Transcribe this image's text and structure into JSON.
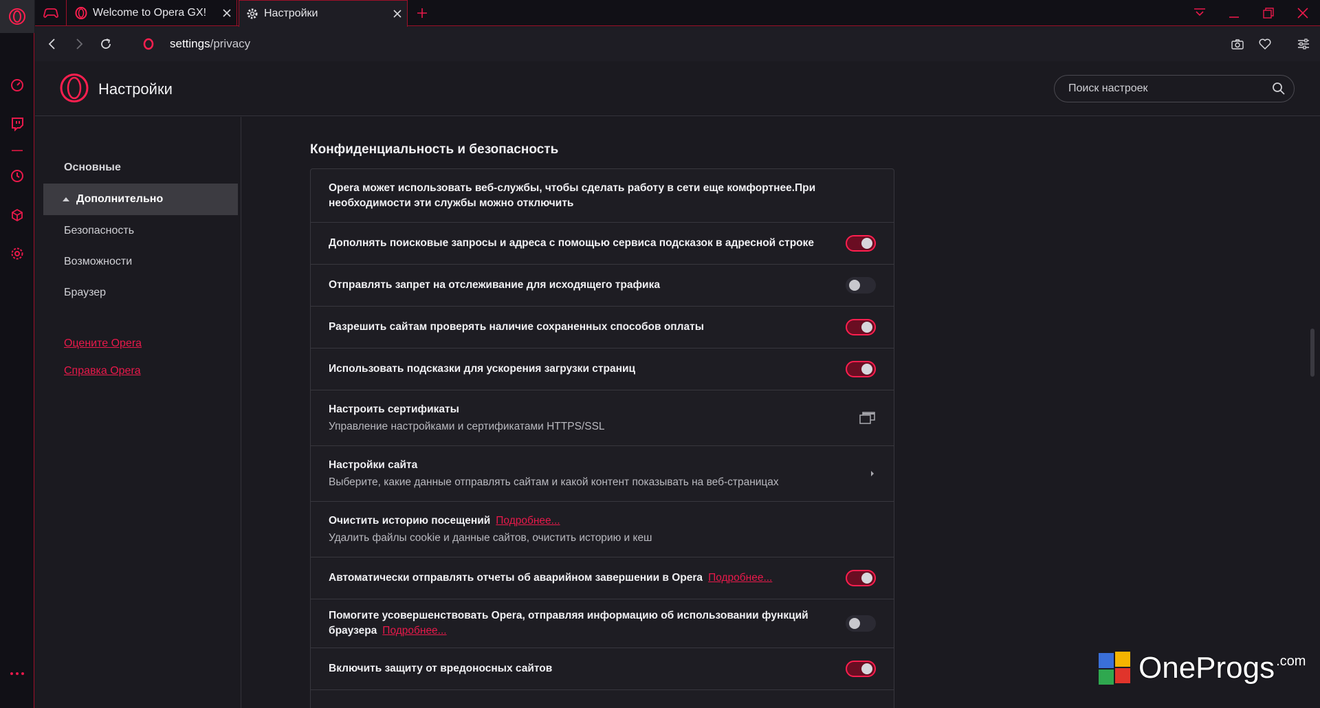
{
  "browser": {
    "tabs": [
      {
        "title": "Welcome to Opera GX!"
      },
      {
        "title": "Настройки"
      }
    ],
    "url_prefix": "settings",
    "url_path": "/privacy"
  },
  "colors": {
    "accent": "#ff1f4f",
    "background": "#1b1a20",
    "card": "#1e1d23"
  },
  "header": {
    "title": "Настройки",
    "search_placeholder": "Поиск настроек"
  },
  "nav": {
    "items": [
      {
        "label": "Основные"
      },
      {
        "label": "Дополнительно"
      },
      {
        "label": "Безопасность"
      },
      {
        "label": "Возможности"
      },
      {
        "label": "Браузер"
      }
    ],
    "links": [
      {
        "label": "Оцените Opera"
      },
      {
        "label": "Справка Opera"
      }
    ]
  },
  "section": {
    "title": "Конфиденциальность и безопасность",
    "intro": "Opera может использовать веб-службы, чтобы сделать работу в сети еще комфортнее.При необходимости эти службы можно отключить",
    "rows": [
      {
        "label": "Дополнять поисковые запросы и адреса с помощью сервиса подсказок в адресной строке",
        "toggle": true
      },
      {
        "label": "Отправлять запрет на отслеживание для исходящего трафика",
        "toggle": false
      },
      {
        "label": "Разрешить сайтам проверять наличие сохраненных способов оплаты",
        "toggle": true
      },
      {
        "label": "Использовать подсказки для ускорения загрузки страниц",
        "toggle": true
      },
      {
        "label": "Настроить сертификаты",
        "sub": "Управление настройками и сертификатами HTTPS/SSL"
      },
      {
        "label": "Настройки сайта",
        "sub": "Выберите, какие данные отправлять сайтам и какой контент показывать на веб-страницах"
      },
      {
        "label": "Очистить историю посещений",
        "more": "Подробнее...",
        "sub": "Удалить файлы cookie и данные сайтов, очистить историю и кеш"
      },
      {
        "label": "Автоматически отправлять отчеты об аварийном завершении в Opera",
        "more": "Подробнее...",
        "toggle": true
      },
      {
        "label": "Помогите усовершенствовать Opera, отправляя информацию об использовании функций браузера",
        "more": "Подробнее...",
        "toggle": false
      },
      {
        "label": "Включить защиту от вредоносных сайтов",
        "toggle": true
      }
    ]
  },
  "watermark": {
    "brand": "OneProgs",
    "domain": ".com"
  }
}
